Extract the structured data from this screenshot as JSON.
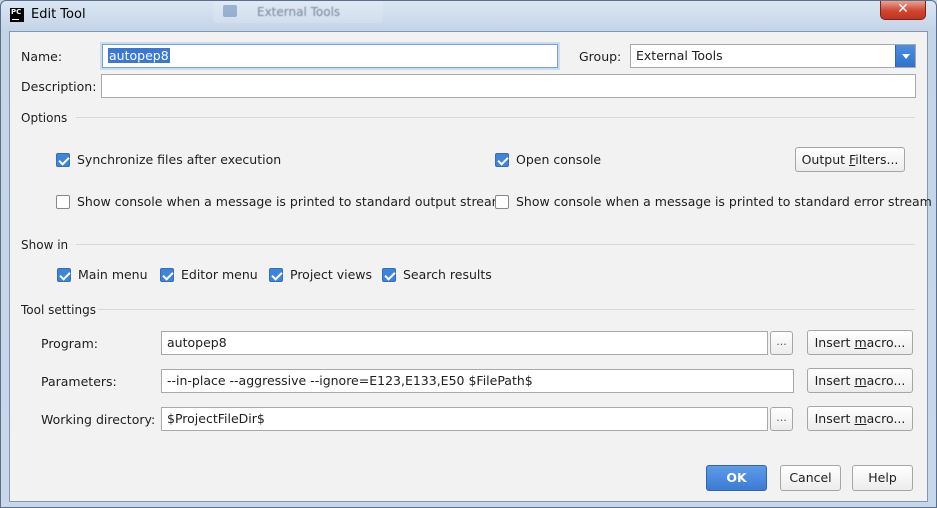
{
  "window": {
    "title": "Edit Tool",
    "app_icon_text": "PC",
    "background_tab": "External Tools",
    "close_symbol": "✕"
  },
  "name_field": {
    "label": "Name:",
    "value": "autopep8"
  },
  "group_field": {
    "label": "Group:",
    "value": "External Tools"
  },
  "description_field": {
    "label": "Description:",
    "value": ""
  },
  "options": {
    "title": "Options",
    "sync_files": {
      "label": "Synchronize files after execution",
      "checked": true
    },
    "open_console": {
      "label": "Open console",
      "checked": true
    },
    "show_console_stdout": {
      "label": "Show console when a message is printed to standard output stream",
      "checked": false
    },
    "show_console_stderr": {
      "label": "Show console when a message is printed to standard error stream",
      "checked": false
    },
    "output_filters_button": {
      "before": "Output ",
      "mnemonic": "F",
      "after": "ilters..."
    }
  },
  "show_in": {
    "title": "Show in",
    "items": [
      {
        "label": "Main menu",
        "checked": true
      },
      {
        "label": "Editor menu",
        "checked": true
      },
      {
        "label": "Project views",
        "checked": true
      },
      {
        "label": "Search results",
        "checked": true
      }
    ]
  },
  "tool_settings": {
    "title": "Tool settings",
    "program": {
      "label": "Program:",
      "value": "autopep8"
    },
    "parameters": {
      "label": "Parameters:",
      "value": "--in-place --aggressive --ignore=E123,E133,E50 $FilePath$"
    },
    "working_directory": {
      "label": "Working directory:",
      "value": "$ProjectFileDir$"
    },
    "browse_label": "...",
    "insert_macro": {
      "before": "Insert ",
      "mnemonic": "m",
      "after": "acro..."
    }
  },
  "footer": {
    "ok": "OK",
    "cancel": "Cancel",
    "help": "Help"
  },
  "colors": {
    "accent": "#3f84d8",
    "primary_button": "#3c7bd3",
    "close_button": "#d0452f"
  }
}
